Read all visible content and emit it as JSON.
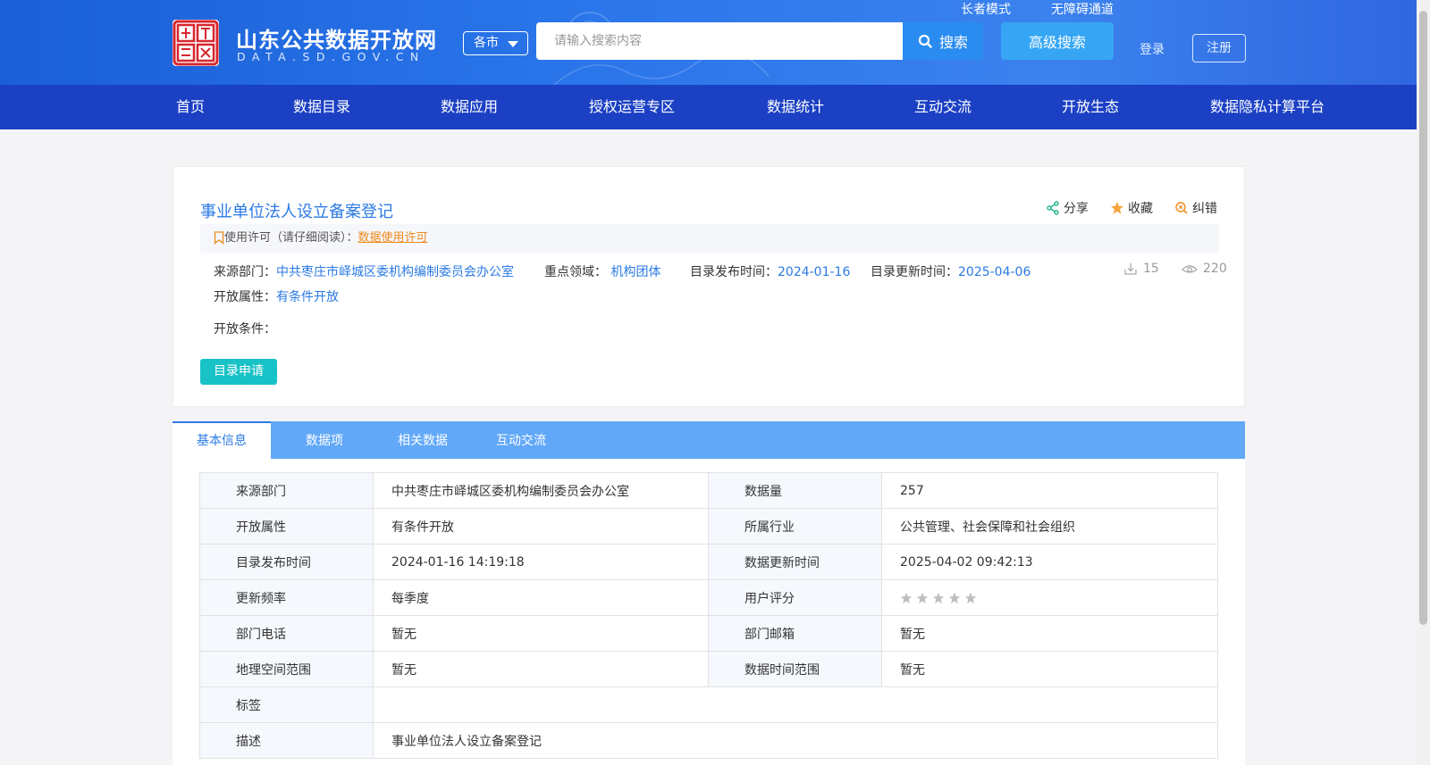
{
  "header": {
    "site_title": "山东公共数据开放网",
    "site_domain": "DATA.SD.GOV.CN",
    "logo_seal_text": "中国山东",
    "city_select": "各市",
    "search_placeholder": "请输入搜索内容",
    "search_button": "搜索",
    "advanced_search": "高级搜索",
    "elder_mode": "长者模式",
    "accessibility": "无障碍通道",
    "login": "登录",
    "register": "注册",
    "colors": {
      "header_bg": "#2a75ea",
      "nav_bg": "#1b40c4",
      "accent": "#2b7ae4"
    }
  },
  "nav": {
    "items": [
      "首页",
      "数据目录",
      "数据应用",
      "授权运营专区",
      "数据统计",
      "互动交流",
      "开放生态",
      "数据隐私计算平台"
    ]
  },
  "dataset": {
    "title": "事业单位法人设立备案登记",
    "actions": {
      "share": "分享",
      "favorite": "收藏",
      "report": "纠错"
    },
    "license_label": "使用许可（请仔细阅读）：",
    "license_link": "数据使用许可",
    "source_label": "来源部门：",
    "source_value": "中共枣庄市峄城区委机构编制委员会办公室",
    "domain_label": "重点领域：",
    "domain_value": "机构团体",
    "publish_label": "目录发布时间：",
    "publish_value": "2024-01-16",
    "update_label": "目录更新时间：",
    "update_value": "2025-04-06",
    "downloads": "15",
    "views": "220",
    "open_attr_label": "开放属性：",
    "open_attr_value": "有条件开放",
    "open_cond_label": "开放条件：",
    "apply_button": "目录申请"
  },
  "tabs": [
    "基本信息",
    "数据项",
    "相关数据",
    "互动交流"
  ],
  "basic_info": {
    "source_dept_k": "来源部门",
    "source_dept_v": "中共枣庄市峄城区委机构编制委员会办公室",
    "data_count_k": "数据量",
    "data_count_v": "257",
    "open_attr_k": "开放属性",
    "open_attr_v": "有条件开放",
    "industry_k": "所属行业",
    "industry_v": "公共管理、社会保障和社会组织",
    "publish_k": "目录发布时间",
    "publish_v": "2024-01-16 14:19:18",
    "data_update_k": "数据更新时间",
    "data_update_v": "2025-04-02 09:42:13",
    "freq_k": "更新频率",
    "freq_v": "每季度",
    "rating_k": "用户评分",
    "rating_value": 0,
    "rating_max": 5,
    "phone_k": "部门电话",
    "phone_v": "暂无",
    "email_k": "部门邮箱",
    "email_v": "暂无",
    "geo_k": "地理空间范围",
    "geo_v": "暂无",
    "time_range_k": "数据时间范围",
    "time_range_v": "暂无",
    "tags_k": "标签",
    "tags_v": "",
    "desc_k": "描述",
    "desc_v": "事业单位法人设立备案登记"
  }
}
